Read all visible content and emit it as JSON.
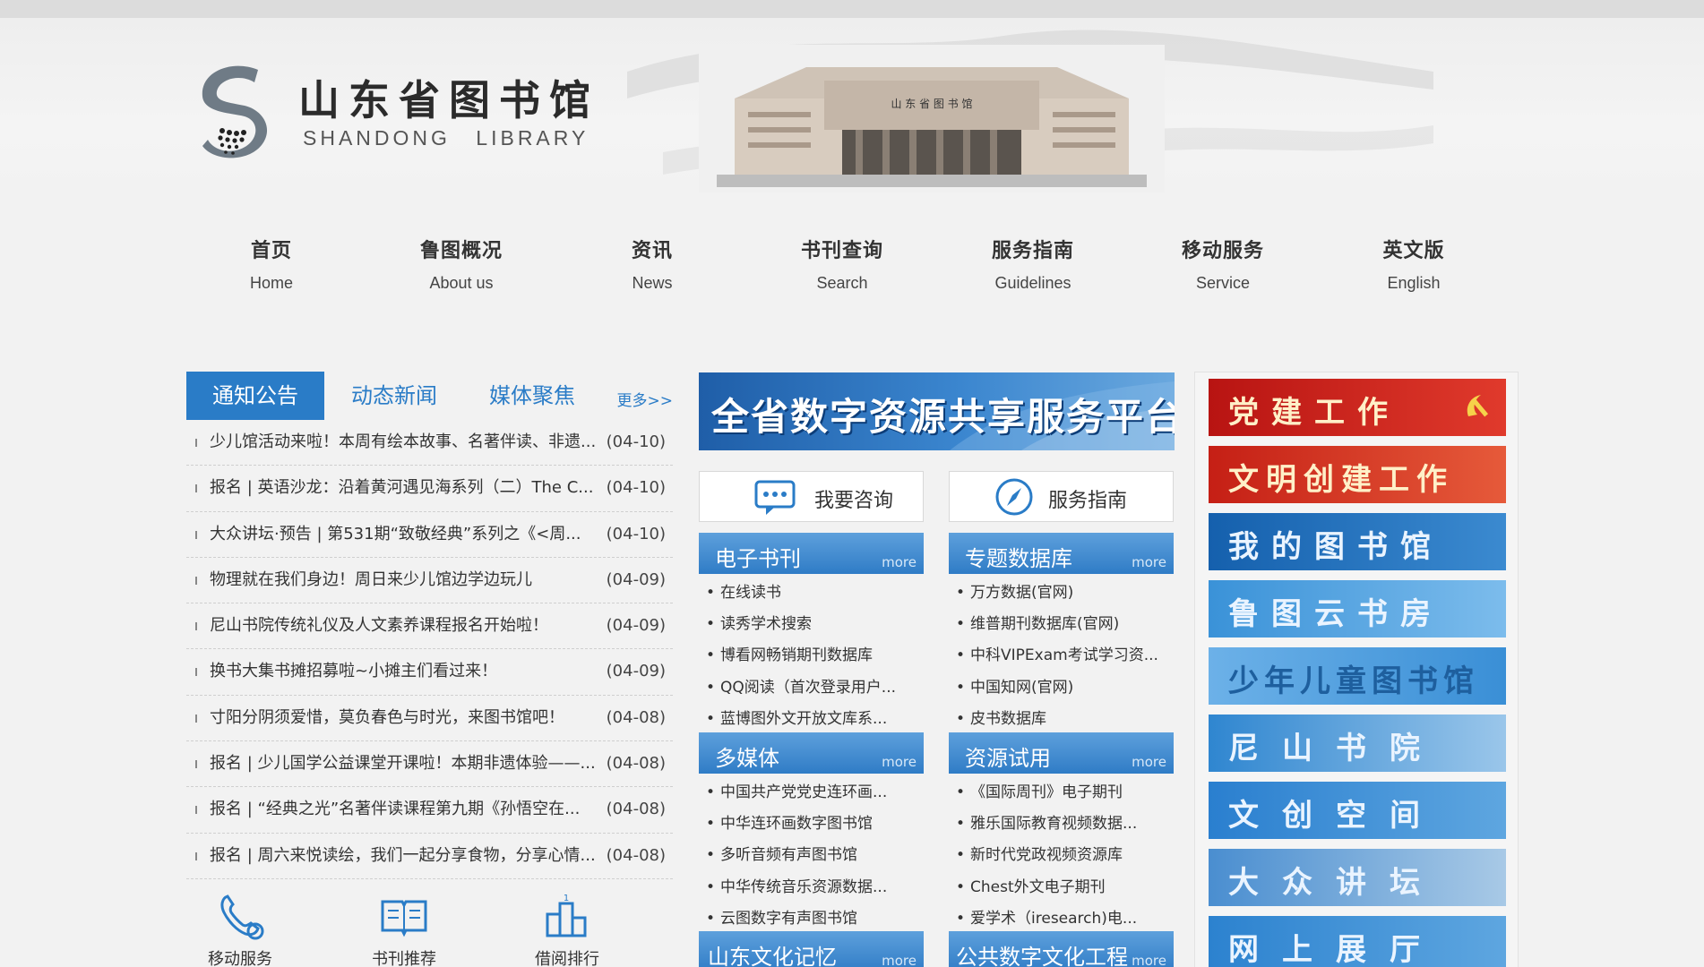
{
  "logo": {
    "cn": "山东省图书馆",
    "en": "SHANDONG LIBRARY"
  },
  "building_sign": "山 东 省 图 书 馆",
  "nav": [
    {
      "cn": "首页",
      "en": "Home"
    },
    {
      "cn": "鲁图概况",
      "en": "About us"
    },
    {
      "cn": "资讯",
      "en": "News"
    },
    {
      "cn": "书刊查询",
      "en": "Search"
    },
    {
      "cn": "服务指南",
      "en": "Guidelines"
    },
    {
      "cn": "移动服务",
      "en": "Service"
    },
    {
      "cn": "英文版",
      "en": "English"
    }
  ],
  "tabs": {
    "items": [
      "通知公告",
      "动态新闻",
      "媒体聚焦"
    ],
    "more": "更多>>"
  },
  "news": [
    {
      "title": "少儿馆活动来啦！本周有绘本故事、名著伴读、非遗...",
      "date": "(04-10)"
    },
    {
      "title": "报名 | 英语沙龙：沿着黄河遇见海系列（二）The C...",
      "date": "(04-10)"
    },
    {
      "title": "大众讲坛·预告 | 第531期“致敬经典”系列之《<周...",
      "date": "(04-10)"
    },
    {
      "title": "物理就在我们身边！周日来少儿馆边学边玩儿",
      "date": "(04-09)"
    },
    {
      "title": "尼山书院传统礼仪及人文素养课程报名开始啦！",
      "date": "(04-09)"
    },
    {
      "title": "换书大集书摊招募啦~小摊主们看过来！",
      "date": "(04-09)"
    },
    {
      "title": "寸阳分阴须爱惜，莫负春色与时光，来图书馆吧！",
      "date": "(04-08)"
    },
    {
      "title": "报名 | 少儿国学公益课堂开课啦！本期非遗体验——...",
      "date": "(04-08)"
    },
    {
      "title": "报名 | “经典之光”名著伴读课程第九期《孙悟空在...",
      "date": "(04-08)"
    },
    {
      "title": "报名 | 周六来悦读绘，我们一起分享食物，分享心情...",
      "date": "(04-08)"
    }
  ],
  "quick": [
    {
      "label": "移动服务",
      "icon": "phone-icon"
    },
    {
      "label": "书刊推荐",
      "icon": "book-icon"
    },
    {
      "label": "借阅排行",
      "icon": "ranking-icon"
    }
  ],
  "banner": {
    "text": "全省数字资源共享服务平台"
  },
  "service_buttons": {
    "consult": "我要咨询",
    "guide": "服务指南"
  },
  "panels": {
    "ebooks": {
      "title": "电子书刊",
      "more": "more",
      "items": [
        "在线读书",
        "读秀学术搜索",
        "博看网畅销期刊数据库",
        "QQ阅读（首次登录用户...",
        "蓝博图外文开放文库系..."
      ]
    },
    "databases": {
      "title": "专题数据库",
      "more": "more",
      "items": [
        "万方数据(官网)",
        "维普期刊数据库(官网)",
        "中科VIPExam考试学习资...",
        "中国知网(官网)",
        "皮书数据库"
      ]
    },
    "multimedia": {
      "title": "多媒体",
      "more": "more",
      "items": [
        "中国共产党党史连环画...",
        "中华连环画数字图书馆",
        "多听音频有声图书馆",
        "中华传统音乐资源数据...",
        "云图数字有声图书馆"
      ]
    },
    "trial": {
      "title": "资源试用",
      "more": "more",
      "items": [
        "《国际周刊》电子期刊",
        "雅乐国际教育视频数据...",
        "新时代党政视频资源库",
        "Chest外文电子期刊",
        "爱学术（iresearch)电..."
      ]
    },
    "memory": {
      "title": "山东文化记忆",
      "more": "more"
    },
    "public_digital": {
      "title": "公共数字文化工程",
      "more": "more"
    }
  },
  "right_links": [
    {
      "label": "党建工作",
      "color": "#c8201c"
    },
    {
      "label": "文明创建工作",
      "color": "#d0281c"
    },
    {
      "label": "我的图书馆",
      "color": "#1d6fb8"
    },
    {
      "label": "鲁图云书房",
      "color": "#3d95d8"
    },
    {
      "label": "少年儿童图书馆",
      "color": "#3a8fd6"
    },
    {
      "label": "尼山书院",
      "color": "#2f86d0"
    },
    {
      "label": "文创空间",
      "color": "#2a7fcf"
    },
    {
      "label": "大众讲坛",
      "color": "#4a8ed0"
    },
    {
      "label": "网上展厅",
      "color": "#2c82cf"
    }
  ]
}
